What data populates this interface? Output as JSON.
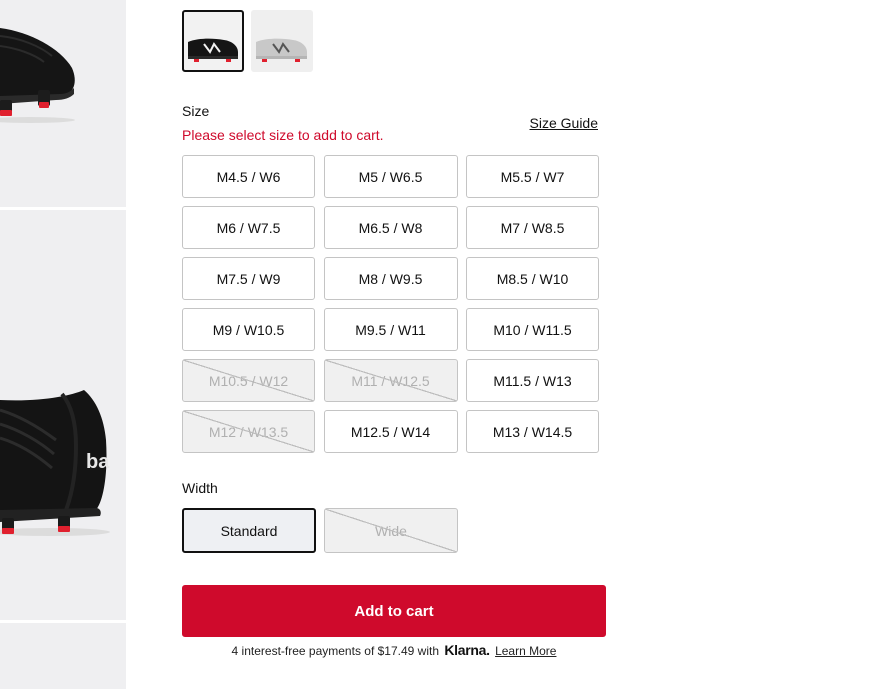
{
  "gallery": {
    "images": [
      "cleat-front-view",
      "cleat-heel-view",
      "cleat-detail-view"
    ]
  },
  "color_swatches": [
    {
      "name": "black",
      "selected": true
    },
    {
      "name": "grey",
      "selected": false
    }
  ],
  "size": {
    "label": "Size",
    "error": "Please select size to add to cart.",
    "guide_label": "Size Guide",
    "options": [
      {
        "label": "M4.5 / W6",
        "available": true
      },
      {
        "label": "M5 / W6.5",
        "available": true
      },
      {
        "label": "M5.5 / W7",
        "available": true
      },
      {
        "label": "M6 / W7.5",
        "available": true
      },
      {
        "label": "M6.5 / W8",
        "available": true
      },
      {
        "label": "M7 / W8.5",
        "available": true
      },
      {
        "label": "M7.5 / W9",
        "available": true
      },
      {
        "label": "M8 / W9.5",
        "available": true
      },
      {
        "label": "M8.5 / W10",
        "available": true
      },
      {
        "label": "M9 / W10.5",
        "available": true
      },
      {
        "label": "M9.5 / W11",
        "available": true
      },
      {
        "label": "M10 / W11.5",
        "available": true
      },
      {
        "label": "M10.5 / W12",
        "available": false
      },
      {
        "label": "M11 / W12.5",
        "available": false
      },
      {
        "label": "M11.5 / W13",
        "available": true
      },
      {
        "label": "M12 / W13.5",
        "available": false
      },
      {
        "label": "M12.5 / W14",
        "available": true
      },
      {
        "label": "M13 / W14.5",
        "available": true
      }
    ]
  },
  "width": {
    "label": "Width",
    "options": [
      {
        "label": "Standard",
        "selected": true,
        "available": true
      },
      {
        "label": "Wide",
        "selected": false,
        "available": false
      }
    ]
  },
  "cart": {
    "add_label": "Add to cart"
  },
  "klarna": {
    "prefix": "4 interest-free payments of",
    "amount": "$17.49",
    "with": "with",
    "brand": "Klarna.",
    "learn_more": "Learn More"
  },
  "colors": {
    "accent": "#cf0a2c",
    "panel_bg": "#efeff1"
  }
}
